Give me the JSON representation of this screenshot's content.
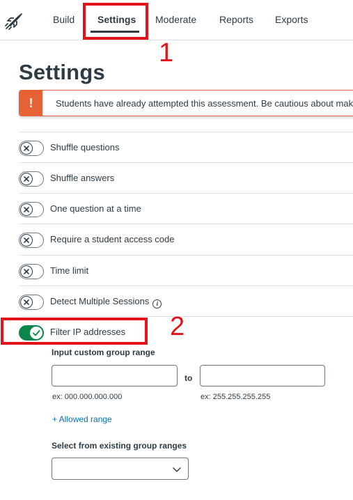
{
  "nav": {
    "tabs": [
      {
        "label": "Build"
      },
      {
        "label": "Settings"
      },
      {
        "label": "Moderate"
      },
      {
        "label": "Reports"
      },
      {
        "label": "Exports"
      }
    ],
    "logo_icon": "rocket-icon"
  },
  "annotations": {
    "one": "1",
    "two": "2",
    "color": "#e3131b"
  },
  "page": {
    "title": "Settings"
  },
  "alert": {
    "icon": "!",
    "text": "Students have already attempted this assessment. Be cautious about maki",
    "color": "#e66135"
  },
  "settings": [
    {
      "label": "Shuffle questions",
      "enabled": false
    },
    {
      "label": "Shuffle answers",
      "enabled": false
    },
    {
      "label": "One question at a time",
      "enabled": false
    },
    {
      "label": "Require a student access code",
      "enabled": false
    },
    {
      "label": "Time limit",
      "enabled": false
    },
    {
      "label": "Detect Multiple Sessions",
      "enabled": false,
      "info_icon": "info-icon"
    },
    {
      "label": "Filter IP addresses",
      "enabled": true
    }
  ],
  "ip_filter": {
    "custom_range_label": "Input custom group range",
    "from_value": "",
    "to_label": "to",
    "to_value": "",
    "from_hint": "ex: 000.000.000.000",
    "to_hint": "ex: 255.255.255.255",
    "add_link": "+ Allowed range",
    "existing_label": "Select from existing group ranges",
    "existing_selected": ""
  },
  "colors": {
    "toggle_on": "#0b874b",
    "link": "#0374b5",
    "text": "#2d3b45"
  }
}
